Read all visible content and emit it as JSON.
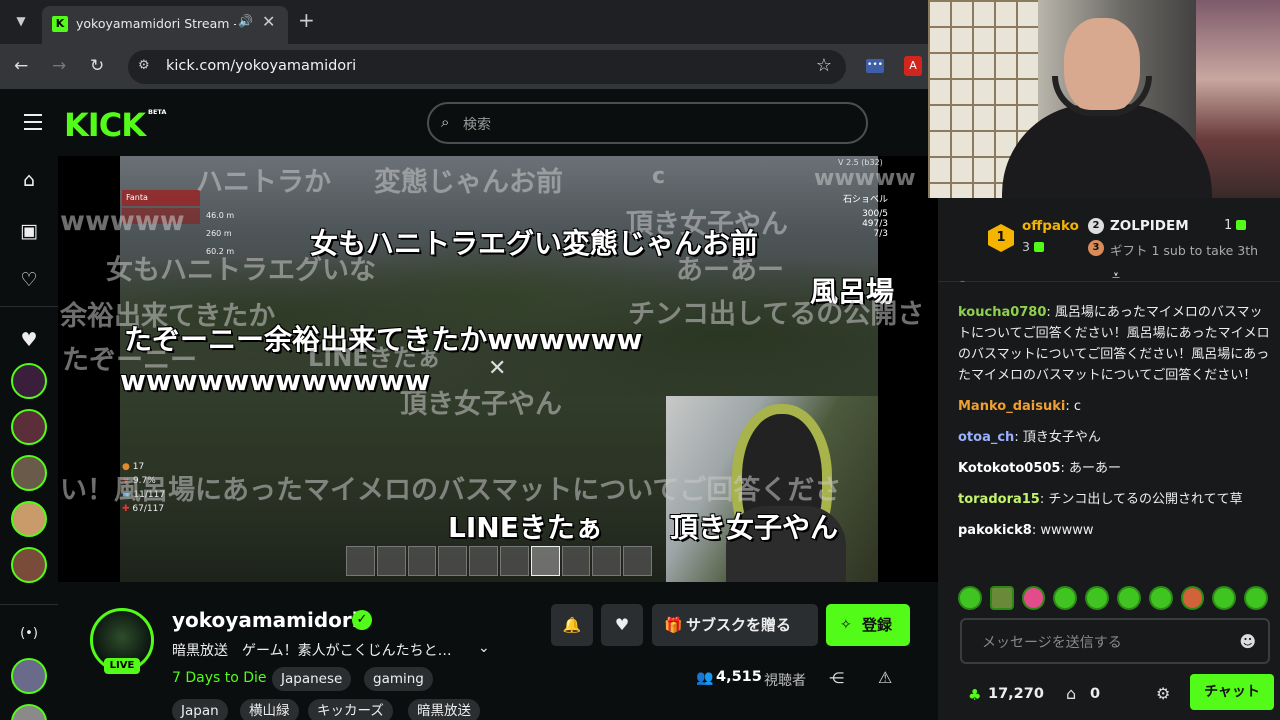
{
  "browser": {
    "tab_title": "yokoyamamidori Stream - V",
    "url": "kick.com/yokoyamamidori"
  },
  "header": {
    "logo": "KICK",
    "beta": "BETA",
    "search_placeholder": "検索"
  },
  "video": {
    "hud": {
      "version": "V 2.5 (b32)",
      "player_name": "Fanta",
      "stat1": "46.0 m",
      "stat2": "260 m",
      "stat3": "60.2 m",
      "item_name": "石ショベル",
      "ammo1": "300/5",
      "ammo2": "497/3",
      "ammo3": "7/3",
      "food": "17",
      "rad": "9.7%",
      "stamina": "11/117",
      "health": "67/117"
    },
    "danmaku": [
      {
        "text": "ハニトラか",
        "style": "faint"
      },
      {
        "text": "変態じゃんお前",
        "style": "faint"
      },
      {
        "text": "c",
        "style": "faint"
      },
      {
        "text": "wwwww",
        "style": "faint"
      },
      {
        "text": "wwwww",
        "style": "faint"
      },
      {
        "text": "頂き女子やん",
        "style": "faint"
      },
      {
        "text": "女もハニトラエグい変態じゃんお前",
        "style": "big"
      },
      {
        "text": "女もハニトラエグいな",
        "style": "faint"
      },
      {
        "text": "あーあー",
        "style": "faint"
      },
      {
        "text": "風呂場",
        "style": "big"
      },
      {
        "text": "余裕出来てきたか",
        "style": "faint"
      },
      {
        "text": "チンコ出してるの公開さ",
        "style": "faint"
      },
      {
        "text": "たぞーニー余裕出来てきたかwwwwww",
        "style": "big"
      },
      {
        "text": "LINEきたぁ",
        "style": "faint"
      },
      {
        "text": "たぞーニー",
        "style": "faint"
      },
      {
        "text": "wwwwwwwwwwww",
        "style": "big"
      },
      {
        "text": "頂き女子やん",
        "style": "faint"
      },
      {
        "text": "い！風呂場にあったマイメロのバスマットについてご回答くださ",
        "style": "faint"
      },
      {
        "text": "LINEきたぁ",
        "style": "big"
      },
      {
        "text": "頂き女子やん",
        "style": "big"
      }
    ]
  },
  "sidebar": {
    "icons": [
      "home-icon",
      "browse-icon",
      "following-icon"
    ]
  },
  "stream": {
    "channel_name": "yokoyamamidori",
    "live_label": "LIVE",
    "title": "暗黒放送　ゲーム！素人がこくじんたちと…",
    "category": "7 Days to Die",
    "tags": [
      "Japanese",
      "gaming",
      "Japan",
      "横山緑",
      "キッカーズ",
      "暗黒放送"
    ],
    "gift_sub_label": "サブスクを贈る",
    "subscribe_label": "登録",
    "viewer_count": "4,515",
    "viewer_label": "視聴者"
  },
  "chat": {
    "top_gifter_1": {
      "rank": "1",
      "name": "offpako",
      "count": "3"
    },
    "top_gifter_2": {
      "rank": "2",
      "name": "ZOLPIDEM",
      "count": "1"
    },
    "top_gifter_3": {
      "rank": "3",
      "text": "ギフト 1 sub to take 3th"
    },
    "messages": [
      {
        "user": "koucha0780",
        "color": "#8fd14f",
        "text": "風呂場にあったマイメロのバスマットについてご回答ください！風呂場にあったマイメロのバスマットについてご回答ください！風呂場にあったマイメロのバスマットについてご回答ください！"
      },
      {
        "user": "Manko_daisuki",
        "color": "#f0a030",
        "text": "c"
      },
      {
        "user": "otoa_ch",
        "color": "#9ab0ff",
        "text": "頂き女子やん"
      },
      {
        "user": "Kotokoto0505",
        "color": "#ffffff",
        "text": "あーあー"
      },
      {
        "user": "toradora15",
        "color": "#c3f56a",
        "text": "チンコ出してるの公開されてて草"
      },
      {
        "user": "pakokick8",
        "color": "#ffffff",
        "text": "wwwww"
      }
    ],
    "input_placeholder": "メッセージを送信する",
    "points": "17,270",
    "store_count": "0",
    "chat_button": "チャット"
  }
}
